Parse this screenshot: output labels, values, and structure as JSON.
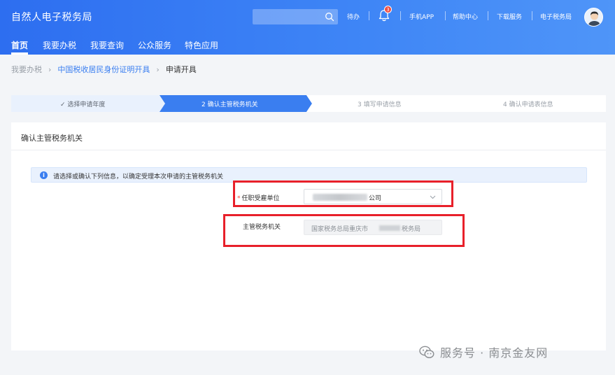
{
  "header": {
    "brand": "自然人电子税务局",
    "search_placeholder": "",
    "todo": "待办",
    "notification_count": "3",
    "links": [
      "手机APP",
      "帮助中心",
      "下载服务",
      "电子税务局"
    ]
  },
  "nav": {
    "items": [
      "首页",
      "我要办税",
      "我要查询",
      "公众服务",
      "特色应用"
    ]
  },
  "breadcrumb": {
    "items": [
      "我要办税",
      "中国税收居民身份证明开具",
      "申请开具"
    ]
  },
  "steps": {
    "items": [
      {
        "label": "✓ 选择申请年度",
        "state": "done"
      },
      {
        "label": "2  确认主管税务机关",
        "state": "active"
      },
      {
        "label": "3  填写申请信息",
        "state": "todo"
      },
      {
        "label": "4  确认申请表信息",
        "state": "todo"
      }
    ]
  },
  "card": {
    "title": "确认主管税务机关",
    "info_icon": "i",
    "info": "请选择或确认下列信息，以确定受理本次申请的主管税务机关",
    "employer": {
      "required_mark": "*",
      "label": "任职受雇单位",
      "value_suffix": "公司"
    },
    "tax_authority": {
      "label": "主管税务机关",
      "value_prefix": "国家税务总局重庆市",
      "value_suffix": "税务局"
    }
  },
  "watermark": {
    "text": "服务号 · 南京金友网"
  },
  "colors": {
    "primary": "#3a7ef0",
    "header": "#2d6ef0",
    "highlight": "#e8202a"
  }
}
